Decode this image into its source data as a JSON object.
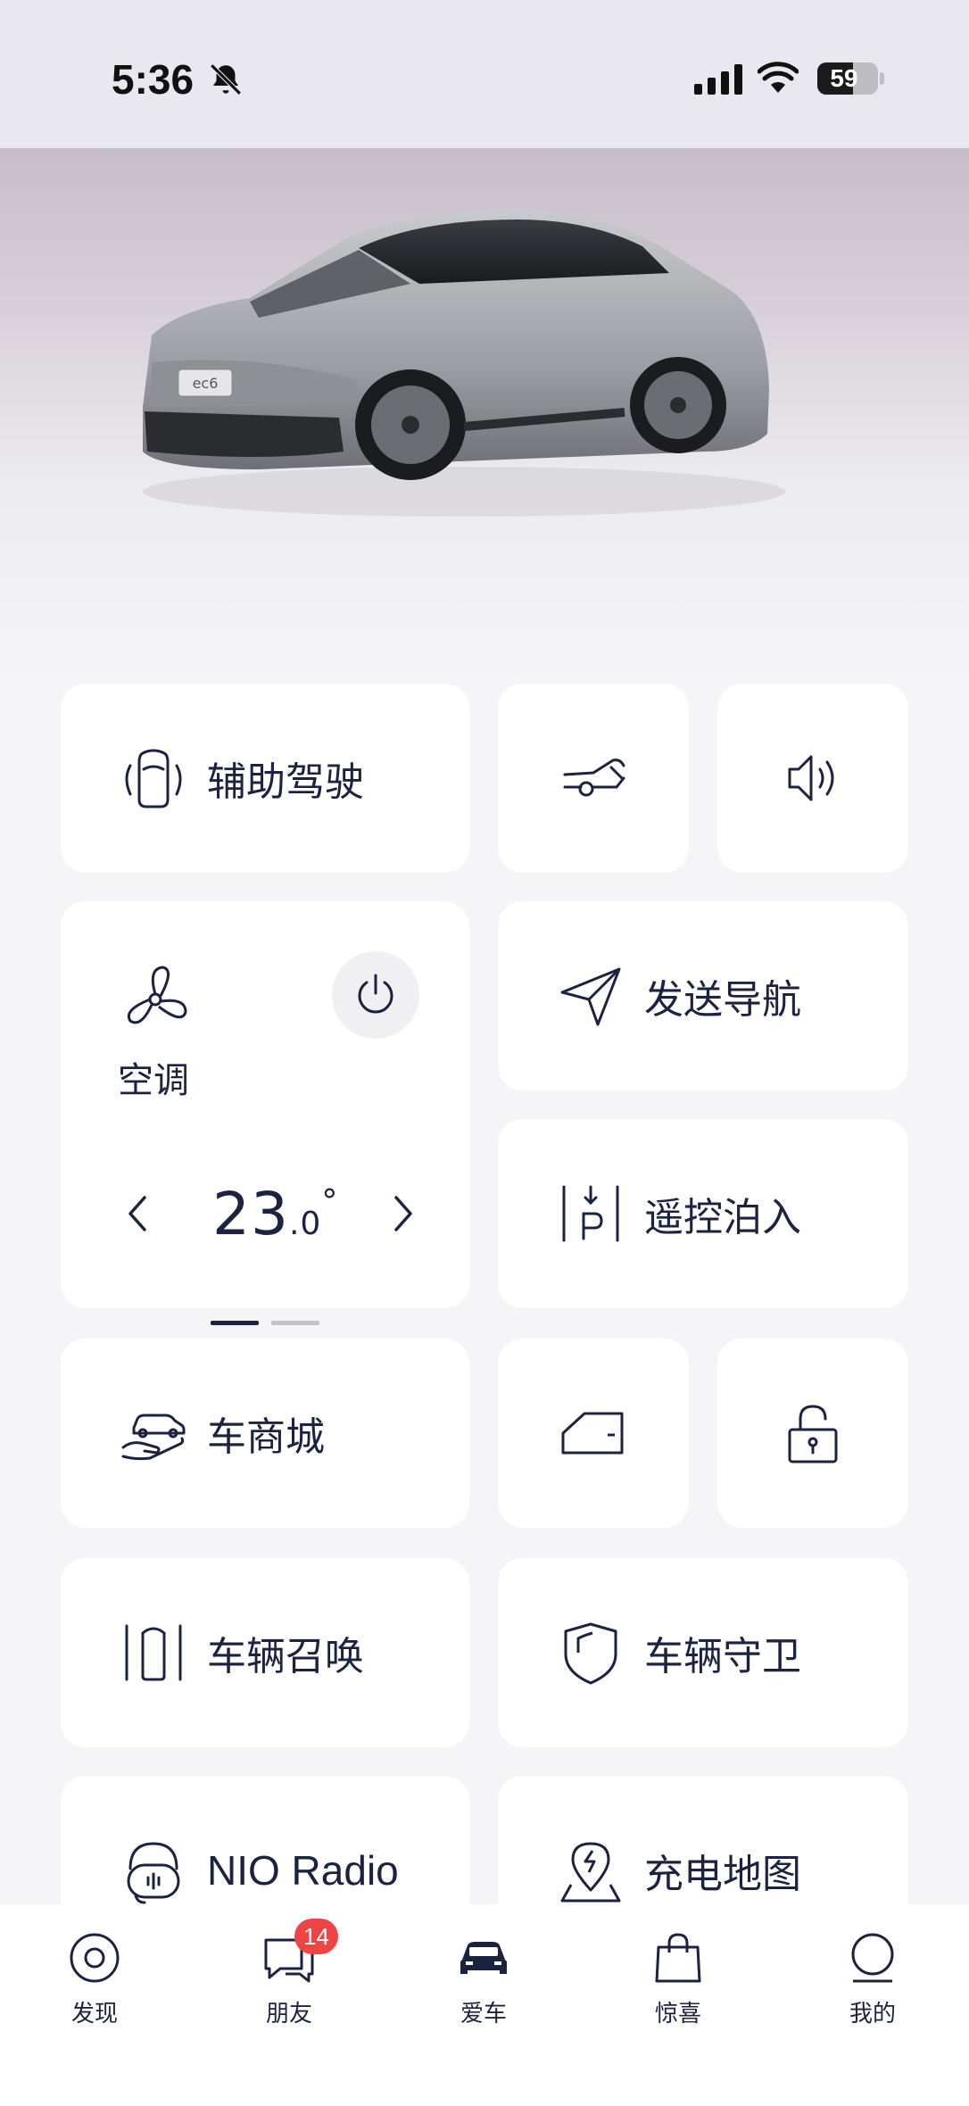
{
  "status_bar": {
    "time": "5:36",
    "battery_level": "59",
    "battery_fraction": 0.59
  },
  "tiles": {
    "assist_drive": "辅助驾驶",
    "send_nav": "发送导航",
    "remote_park": "遥控泊入",
    "mall": "车商城",
    "summon": "车辆召唤",
    "guard": "车辆守卫",
    "radio": "NIO Radio",
    "charge_map": "充电地图"
  },
  "ac": {
    "label": "空调",
    "temp_int": "23",
    "temp_dec": ".0",
    "temp_unit": "°"
  },
  "pager": {
    "pages": 2,
    "active": 1
  },
  "tab_bar": {
    "items": [
      {
        "label": "发现",
        "icon": "discover-icon"
      },
      {
        "label": "朋友",
        "icon": "chat-icon"
      },
      {
        "label": "爱车",
        "icon": "car-icon"
      },
      {
        "label": "惊喜",
        "icon": "shopping-bag-icon"
      },
      {
        "label": "我的",
        "icon": "profile-icon"
      }
    ],
    "friends_badge": "14",
    "active_index": 2
  },
  "colors": {
    "accent": "#1c2340",
    "badge": "#ef4444",
    "tile_bg": "#ffffff",
    "page_bg": "#f5f5f7"
  }
}
